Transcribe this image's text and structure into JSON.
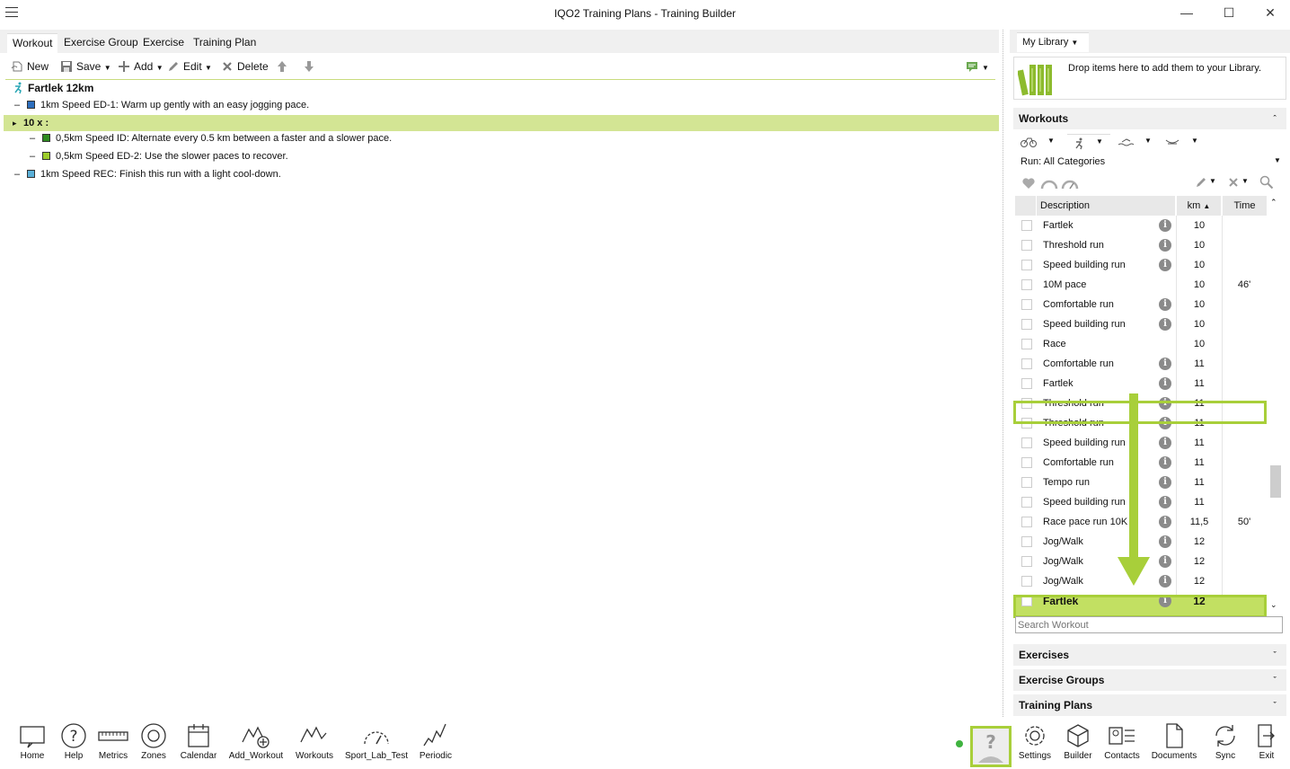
{
  "window": {
    "title": "IQO2 Training Plans - Training Builder"
  },
  "tabs": [
    "Workout",
    "Exercise Group",
    "Exercise",
    "Training Plan"
  ],
  "toolbar": {
    "new": "New",
    "save": "Save",
    "add": "Add",
    "edit": "Edit",
    "delete": "Delete"
  },
  "workout": {
    "title": "Fartlek 12km",
    "steps": [
      {
        "text": "1km Speed ED-1: Warm up gently with an easy jogging pace.",
        "color": "#2e6fbe"
      },
      {
        "text": "10 x :",
        "color": ""
      },
      {
        "text": "0,5km Speed ID: Alternate every 0.5 km between a faster and a slower pace.",
        "color": "#2e8b1f"
      },
      {
        "text": "0,5km Speed ED-2: Use the slower paces to recover.",
        "color": "#9ccc2a"
      },
      {
        "text": "1km Speed REC: Finish this run with a light cool-down.",
        "color": "#5bb0d8"
      }
    ]
  },
  "library": {
    "tab": "My Library",
    "drop_text": "Drop items here to add them to your Library.",
    "workouts_section": "Workouts",
    "category": "Run: All Categories",
    "columns": {
      "description": "Description",
      "km": "km",
      "time": "Time"
    },
    "rows": [
      {
        "desc": "Fartlek",
        "info": true,
        "km": "10",
        "time": ""
      },
      {
        "desc": "Threshold run",
        "info": true,
        "km": "10",
        "time": ""
      },
      {
        "desc": "Speed building run",
        "info": true,
        "km": "10",
        "time": ""
      },
      {
        "desc": "10M pace",
        "info": false,
        "km": "10",
        "time": "46'"
      },
      {
        "desc": "Comfortable run",
        "info": true,
        "km": "10",
        "time": ""
      },
      {
        "desc": "Speed building run",
        "info": true,
        "km": "10",
        "time": ""
      },
      {
        "desc": "Race",
        "info": false,
        "km": "10",
        "time": ""
      },
      {
        "desc": "Comfortable run",
        "info": true,
        "km": "11",
        "time": ""
      },
      {
        "desc": "Fartlek",
        "info": true,
        "km": "11",
        "time": ""
      },
      {
        "desc": "Threshold run",
        "info": true,
        "km": "11",
        "time": ""
      },
      {
        "desc": "Threshold run",
        "info": true,
        "km": "11",
        "time": ""
      },
      {
        "desc": "Speed building run",
        "info": true,
        "km": "11",
        "time": ""
      },
      {
        "desc": "Comfortable run",
        "info": true,
        "km": "11",
        "time": ""
      },
      {
        "desc": "Tempo run",
        "info": true,
        "km": "11",
        "time": ""
      },
      {
        "desc": "Speed building run",
        "info": true,
        "km": "11",
        "time": ""
      },
      {
        "desc": "Race pace run 10K",
        "info": true,
        "km": "11,5",
        "time": "50'"
      },
      {
        "desc": "Jog/Walk",
        "info": true,
        "km": "12",
        "time": ""
      },
      {
        "desc": "Jog/Walk",
        "info": true,
        "km": "12",
        "time": ""
      },
      {
        "desc": "Jog/Walk",
        "info": true,
        "km": "12",
        "time": ""
      },
      {
        "desc": "Fartlek",
        "info": true,
        "km": "12",
        "time": ""
      }
    ],
    "search_placeholder": "Search Workout",
    "exercises_section": "Exercises",
    "exercise_groups_section": "Exercise Groups",
    "training_plans_section": "Training Plans"
  },
  "bottom_left": [
    "Home",
    "Help",
    "Metrics",
    "Zones",
    "Calendar",
    "Add_Workout",
    "Workouts",
    "Sport_Lab_Test",
    "Periodic"
  ],
  "bottom_right": [
    "Settings",
    "Builder",
    "Contacts",
    "Documents",
    "Sync",
    "Exit"
  ],
  "colors": {
    "accent": "#a8cf3a",
    "selection": "#d3e594"
  }
}
